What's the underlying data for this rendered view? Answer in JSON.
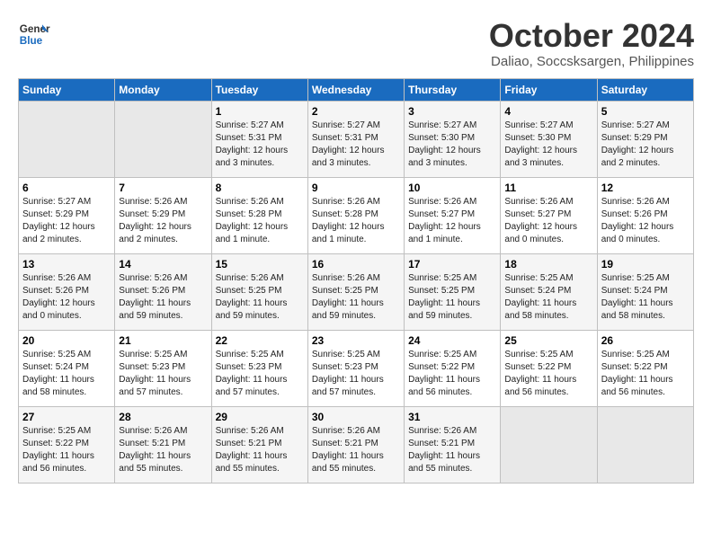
{
  "header": {
    "logo_line1": "General",
    "logo_line2": "Blue",
    "month": "October 2024",
    "location": "Daliao, Soccsksargen, Philippines"
  },
  "days_of_week": [
    "Sunday",
    "Monday",
    "Tuesday",
    "Wednesday",
    "Thursday",
    "Friday",
    "Saturday"
  ],
  "weeks": [
    [
      {
        "day": "",
        "empty": true
      },
      {
        "day": "",
        "empty": true
      },
      {
        "day": "1",
        "sunrise": "Sunrise: 5:27 AM",
        "sunset": "Sunset: 5:31 PM",
        "daylight": "Daylight: 12 hours and 3 minutes."
      },
      {
        "day": "2",
        "sunrise": "Sunrise: 5:27 AM",
        "sunset": "Sunset: 5:31 PM",
        "daylight": "Daylight: 12 hours and 3 minutes."
      },
      {
        "day": "3",
        "sunrise": "Sunrise: 5:27 AM",
        "sunset": "Sunset: 5:30 PM",
        "daylight": "Daylight: 12 hours and 3 minutes."
      },
      {
        "day": "4",
        "sunrise": "Sunrise: 5:27 AM",
        "sunset": "Sunset: 5:30 PM",
        "daylight": "Daylight: 12 hours and 3 minutes."
      },
      {
        "day": "5",
        "sunrise": "Sunrise: 5:27 AM",
        "sunset": "Sunset: 5:29 PM",
        "daylight": "Daylight: 12 hours and 2 minutes."
      }
    ],
    [
      {
        "day": "6",
        "sunrise": "Sunrise: 5:27 AM",
        "sunset": "Sunset: 5:29 PM",
        "daylight": "Daylight: 12 hours and 2 minutes."
      },
      {
        "day": "7",
        "sunrise": "Sunrise: 5:26 AM",
        "sunset": "Sunset: 5:29 PM",
        "daylight": "Daylight: 12 hours and 2 minutes."
      },
      {
        "day": "8",
        "sunrise": "Sunrise: 5:26 AM",
        "sunset": "Sunset: 5:28 PM",
        "daylight": "Daylight: 12 hours and 1 minute."
      },
      {
        "day": "9",
        "sunrise": "Sunrise: 5:26 AM",
        "sunset": "Sunset: 5:28 PM",
        "daylight": "Daylight: 12 hours and 1 minute."
      },
      {
        "day": "10",
        "sunrise": "Sunrise: 5:26 AM",
        "sunset": "Sunset: 5:27 PM",
        "daylight": "Daylight: 12 hours and 1 minute."
      },
      {
        "day": "11",
        "sunrise": "Sunrise: 5:26 AM",
        "sunset": "Sunset: 5:27 PM",
        "daylight": "Daylight: 12 hours and 0 minutes."
      },
      {
        "day": "12",
        "sunrise": "Sunrise: 5:26 AM",
        "sunset": "Sunset: 5:26 PM",
        "daylight": "Daylight: 12 hours and 0 minutes."
      }
    ],
    [
      {
        "day": "13",
        "sunrise": "Sunrise: 5:26 AM",
        "sunset": "Sunset: 5:26 PM",
        "daylight": "Daylight: 12 hours and 0 minutes."
      },
      {
        "day": "14",
        "sunrise": "Sunrise: 5:26 AM",
        "sunset": "Sunset: 5:26 PM",
        "daylight": "Daylight: 11 hours and 59 minutes."
      },
      {
        "day": "15",
        "sunrise": "Sunrise: 5:26 AM",
        "sunset": "Sunset: 5:25 PM",
        "daylight": "Daylight: 11 hours and 59 minutes."
      },
      {
        "day": "16",
        "sunrise": "Sunrise: 5:26 AM",
        "sunset": "Sunset: 5:25 PM",
        "daylight": "Daylight: 11 hours and 59 minutes."
      },
      {
        "day": "17",
        "sunrise": "Sunrise: 5:25 AM",
        "sunset": "Sunset: 5:25 PM",
        "daylight": "Daylight: 11 hours and 59 minutes."
      },
      {
        "day": "18",
        "sunrise": "Sunrise: 5:25 AM",
        "sunset": "Sunset: 5:24 PM",
        "daylight": "Daylight: 11 hours and 58 minutes."
      },
      {
        "day": "19",
        "sunrise": "Sunrise: 5:25 AM",
        "sunset": "Sunset: 5:24 PM",
        "daylight": "Daylight: 11 hours and 58 minutes."
      }
    ],
    [
      {
        "day": "20",
        "sunrise": "Sunrise: 5:25 AM",
        "sunset": "Sunset: 5:24 PM",
        "daylight": "Daylight: 11 hours and 58 minutes."
      },
      {
        "day": "21",
        "sunrise": "Sunrise: 5:25 AM",
        "sunset": "Sunset: 5:23 PM",
        "daylight": "Daylight: 11 hours and 57 minutes."
      },
      {
        "day": "22",
        "sunrise": "Sunrise: 5:25 AM",
        "sunset": "Sunset: 5:23 PM",
        "daylight": "Daylight: 11 hours and 57 minutes."
      },
      {
        "day": "23",
        "sunrise": "Sunrise: 5:25 AM",
        "sunset": "Sunset: 5:23 PM",
        "daylight": "Daylight: 11 hours and 57 minutes."
      },
      {
        "day": "24",
        "sunrise": "Sunrise: 5:25 AM",
        "sunset": "Sunset: 5:22 PM",
        "daylight": "Daylight: 11 hours and 56 minutes."
      },
      {
        "day": "25",
        "sunrise": "Sunrise: 5:25 AM",
        "sunset": "Sunset: 5:22 PM",
        "daylight": "Daylight: 11 hours and 56 minutes."
      },
      {
        "day": "26",
        "sunrise": "Sunrise: 5:25 AM",
        "sunset": "Sunset: 5:22 PM",
        "daylight": "Daylight: 11 hours and 56 minutes."
      }
    ],
    [
      {
        "day": "27",
        "sunrise": "Sunrise: 5:25 AM",
        "sunset": "Sunset: 5:22 PM",
        "daylight": "Daylight: 11 hours and 56 minutes."
      },
      {
        "day": "28",
        "sunrise": "Sunrise: 5:26 AM",
        "sunset": "Sunset: 5:21 PM",
        "daylight": "Daylight: 11 hours and 55 minutes."
      },
      {
        "day": "29",
        "sunrise": "Sunrise: 5:26 AM",
        "sunset": "Sunset: 5:21 PM",
        "daylight": "Daylight: 11 hours and 55 minutes."
      },
      {
        "day": "30",
        "sunrise": "Sunrise: 5:26 AM",
        "sunset": "Sunset: 5:21 PM",
        "daylight": "Daylight: 11 hours and 55 minutes."
      },
      {
        "day": "31",
        "sunrise": "Sunrise: 5:26 AM",
        "sunset": "Sunset: 5:21 PM",
        "daylight": "Daylight: 11 hours and 55 minutes."
      },
      {
        "day": "",
        "empty": true
      },
      {
        "day": "",
        "empty": true
      }
    ]
  ]
}
